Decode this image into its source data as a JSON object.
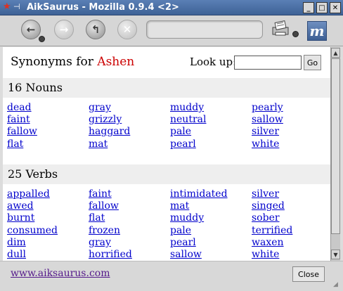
{
  "window": {
    "title": "AikSaurus - Mozilla 0.9.4 <2>",
    "app_icon": "star-icon",
    "controls": [
      "_",
      "□",
      "✕"
    ],
    "colors": {
      "titlebar": "#3e6296",
      "link": "#0000cc",
      "visited": "#551a8b",
      "word": "#cc0000"
    }
  },
  "toolbar": {
    "back_icon": "back-arrow-icon",
    "forward_icon": "forward-arrow-icon",
    "reload_icon": "reload-icon",
    "stop_icon": "stop-icon",
    "print_icon": "print-icon",
    "logo_text": "m",
    "url_value": ""
  },
  "header": {
    "synonyms_for": "Synonyms for",
    "word": "Ashen",
    "lookup_label": "Look up:",
    "lookup_value": "",
    "go_label": "Go"
  },
  "nouns": {
    "heading": "16 Nouns",
    "words": [
      "dead",
      "gray",
      "muddy",
      "pearly",
      "faint",
      "grizzly",
      "neutral",
      "sallow",
      "fallow",
      "haggard",
      "pale",
      "silver",
      "flat",
      "mat",
      "pearl",
      "white"
    ]
  },
  "verbs": {
    "heading": "25 Verbs",
    "words": [
      "appalled",
      "faint",
      "intimidated",
      "silver",
      "awed",
      "fallow",
      "mat",
      "singed",
      "burnt",
      "flat",
      "muddy",
      "sober",
      "consumed",
      "frozen",
      "pale",
      "terrified",
      "dim",
      "gray",
      "pearl",
      "waxen",
      "dull",
      "horrified",
      "sallow",
      "white"
    ]
  },
  "footer": {
    "link": "www.aiksaurus.com",
    "close_label": "Close"
  }
}
